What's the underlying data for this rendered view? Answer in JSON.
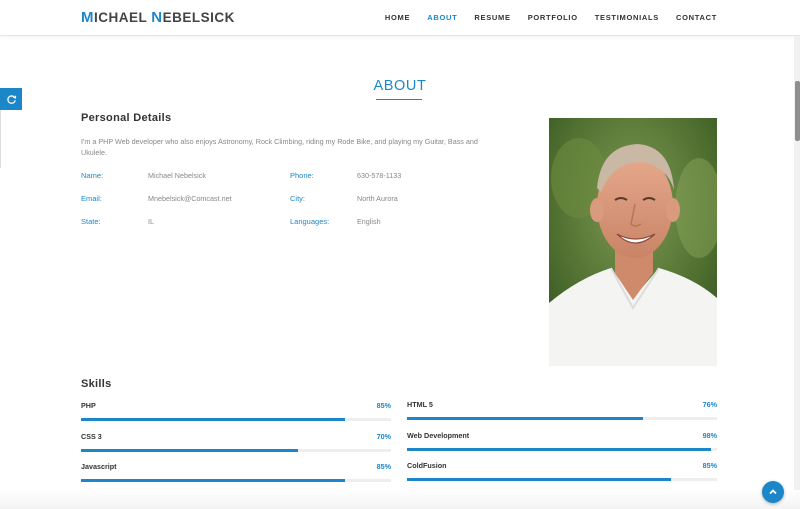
{
  "header": {
    "brand_initial_1": "M",
    "brand_rest_1": "ICHAEL ",
    "brand_initial_2": "N",
    "brand_rest_2": "EBELSICK",
    "nav": [
      "HOME",
      "ABOUT",
      "RESUME",
      "PORTFOLIO",
      "TESTIMONIALS",
      "CONTACT"
    ],
    "active_nav": "ABOUT"
  },
  "about": {
    "title": "ABOUT",
    "personal_heading": "Personal Details",
    "bio": "I'm a PHP Web developer who also enjoys Astronomy, Rock Climbing, riding my Rode Bike, and playing my Guitar, Bass and Ukulele.",
    "fields": {
      "name_label": "Name:",
      "name_value": "Michael Nebelsick",
      "email_label": "Email:",
      "email_value": "Mnebelsick@Comcast.net",
      "state_label": "State:",
      "state_value": "IL",
      "phone_label": "Phone:",
      "phone_value": "630-578-1133",
      "city_label": "City:",
      "city_value": "North Aurora",
      "languages_label": "Languages:",
      "languages_value": "English"
    }
  },
  "skills": {
    "heading": "Skills",
    "items": [
      {
        "name": "PHP",
        "percent": "85%",
        "value": 85
      },
      {
        "name": "HTML 5",
        "percent": "76%",
        "value": 76
      },
      {
        "name": "CSS 3",
        "percent": "70%",
        "value": 70
      },
      {
        "name": "Web Development",
        "percent": "98%",
        "value": 98
      },
      {
        "name": "Javascript",
        "percent": "85%",
        "value": 85
      },
      {
        "name": "ColdFusion",
        "percent": "85%",
        "value": 85
      }
    ]
  },
  "colors": {
    "accent": "#1b87c9",
    "text": "#333333",
    "muted": "#888888"
  },
  "icons": {
    "side_widget": "refresh-icon",
    "back_to_top": "chevron-up-icon"
  }
}
